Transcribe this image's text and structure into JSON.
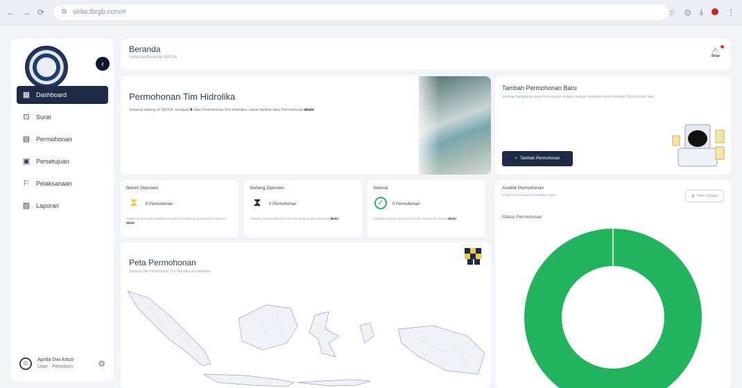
{
  "browser": {
    "url": "sirtia.tbrgb.com/#",
    "nav_back": "←",
    "nav_forward": "→",
    "nav_reload": "⟳"
  },
  "sidebar": {
    "collapse_icon": "chevron-left",
    "items": [
      {
        "label": "Dashboard",
        "icon": "grid-icon",
        "glyph": "▦",
        "active": true
      },
      {
        "label": "Surat",
        "icon": "inbox-icon",
        "glyph": "⊡"
      },
      {
        "label": "Permohonan",
        "icon": "document-icon",
        "glyph": "▤"
      },
      {
        "label": "Persetujuan",
        "icon": "file-check-icon",
        "glyph": "▣"
      },
      {
        "label": "Pelaksanaan",
        "icon": "flag-icon",
        "glyph": "⚐"
      },
      {
        "label": "Laporan",
        "icon": "report-icon",
        "glyph": "▧"
      }
    ],
    "user": {
      "name": "Aprilia Dwi Astuti",
      "role": "User · Pemohon"
    }
  },
  "header": {
    "title": "Beranda",
    "subtitle": "Halaman Beranda SIRTIA"
  },
  "hero": {
    "title": "Permohonan Tim Hidrolika",
    "desc_prefix": "Selamat datang di SIRTIA, terdapat ",
    "desc_count": "8",
    "desc_middle": " data Permohonan Tim Hidrolika, untuk melihat data Permohonan ",
    "desc_link": "disini"
  },
  "add_card": {
    "title": "Tambah Permohonan Baru",
    "desc": "Silahkan tambahkan data Permohonan terbaru dengan menekan tombol tambah Permohonan baru",
    "button": "Tambah Permohonan"
  },
  "stats": [
    {
      "label": "Belum Diproses",
      "count": "8 Permohonan",
      "note": "Segera periksa dan tindaklanjuti data permohonan yang belum diproses",
      "link": "disini",
      "icon": "hourglass-start-icon",
      "color": "#f2c94c"
    },
    {
      "label": "Sedang Diproses",
      "count": "0 Permohonan",
      "note": "Silahkan periksa data permohonan yang sedang diproses",
      "link": "disini",
      "icon": "hourglass-icon",
      "color": "#1e2a46"
    },
    {
      "label": "Selesai",
      "count": "0 Permohonan",
      "note": "Silahkan periksa data permohonan yang telah selesai",
      "link": "disini",
      "icon": "check-circle-icon",
      "color": "#22b35e"
    }
  ],
  "map": {
    "title": "Peta Permohonan",
    "desc": "Sebaran titik Permohonan Tim Hidrolika se-Indonesia"
  },
  "analytics": {
    "title": "Analitik Permohonan",
    "desc": "Grafik Permohonan berdasarkan status",
    "filter": "Filter Tanggal",
    "status_label": "Status Permohonan"
  },
  "chart_data": {
    "type": "pie",
    "variant": "donut",
    "title": "Status Permohonan",
    "categories": [
      "Belum Diproses",
      "Sedang Diproses",
      "Selesai"
    ],
    "values": [
      8,
      0,
      0
    ],
    "colors": [
      "#22b35e",
      "#1e2a46",
      "#f2c94c"
    ]
  },
  "colors": {
    "accent": "#1e2a46",
    "success": "#22b35e",
    "warning": "#f2c94c",
    "danger": "#e53935"
  }
}
